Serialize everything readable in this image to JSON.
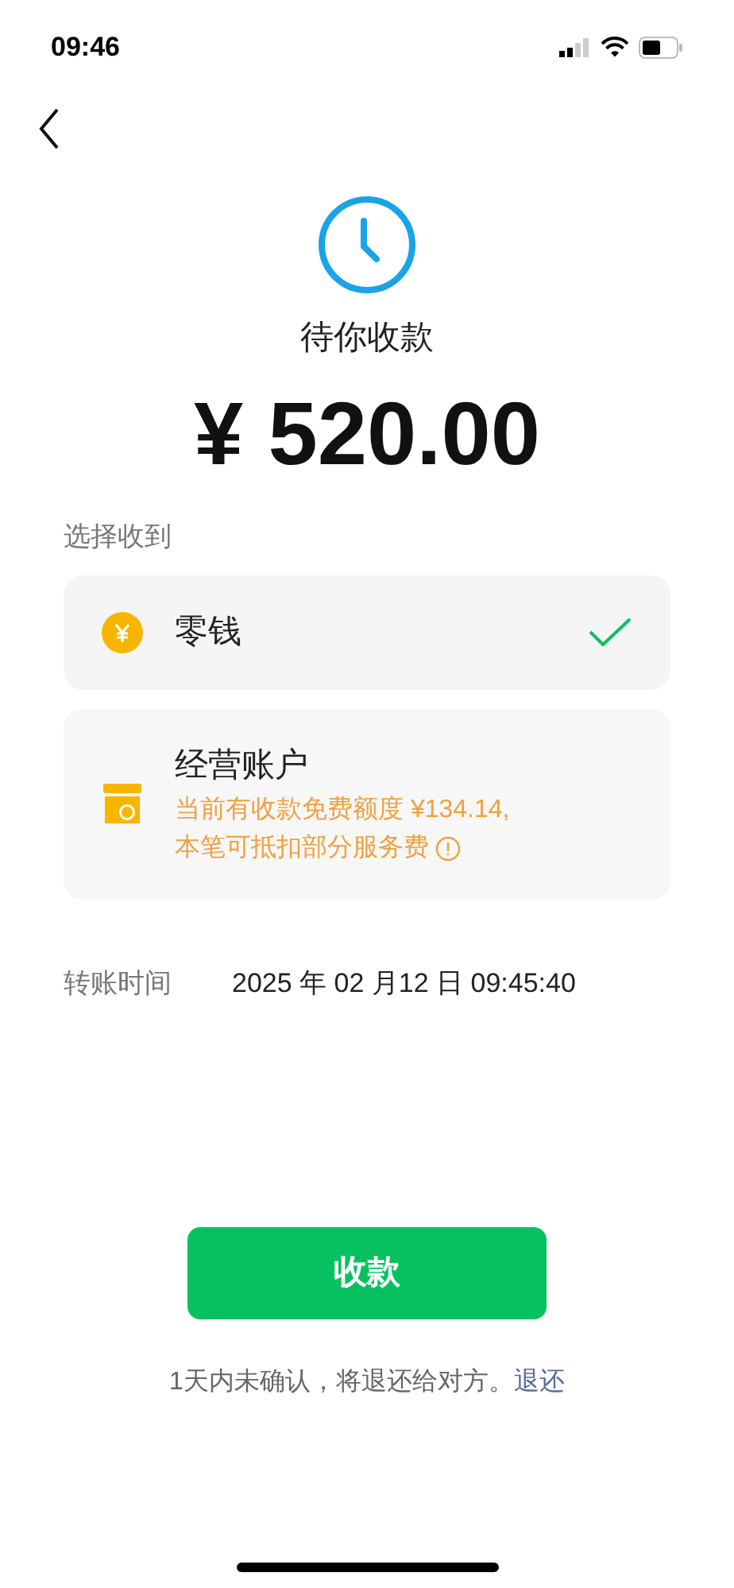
{
  "status_bar": {
    "time": "09:46"
  },
  "status": {
    "title": "待你收款",
    "amount": "¥ 520.00"
  },
  "section_label": "选择收到",
  "accounts": [
    {
      "kind": "change",
      "name": "零钱",
      "selected": true
    },
    {
      "kind": "business",
      "name": "经营账户",
      "selected": false,
      "hint_lines": [
        "当前有收款免费额度 ¥134.14,",
        "本笔可抵扣部分服务费"
      ]
    }
  ],
  "transfer_time": {
    "label": "转账时间",
    "value": "2025 年 02 月12 日 09:45:40"
  },
  "accept_button": "收款",
  "note": {
    "text": "1天内未确认，将退还给对方。",
    "link": "退还"
  }
}
